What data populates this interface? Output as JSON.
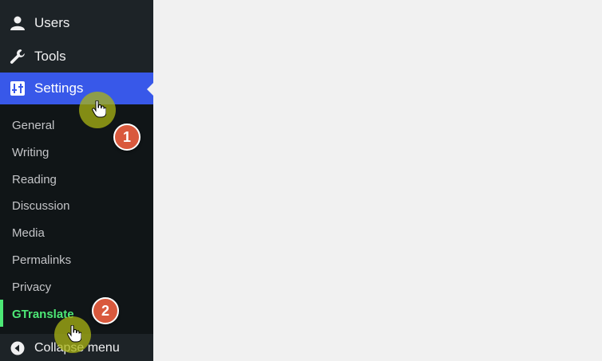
{
  "menu": {
    "users_label": "Users",
    "tools_label": "Tools",
    "settings_label": "Settings",
    "collapse_label": "Collapse menu"
  },
  "settings_submenu": {
    "items": [
      "General",
      "Writing",
      "Reading",
      "Discussion",
      "Media",
      "Permalinks",
      "Privacy",
      "GTranslate"
    ],
    "current": "GTranslate"
  },
  "annotations": {
    "step1": "1",
    "step2": "2"
  },
  "colors": {
    "sidebar_bg": "#1d2327",
    "submenu_bg": "#101517",
    "active_bg": "#3858e9",
    "current_text": "#4de876",
    "badge_bg": "#d9593d",
    "cursor_marker": "#aab414"
  },
  "icons": {
    "users": "user-icon",
    "tools": "wrench-icon",
    "settings": "settings-sliders-icon",
    "collapse": "collapse-arrow-icon",
    "cursor": "hand-pointer-icon"
  }
}
